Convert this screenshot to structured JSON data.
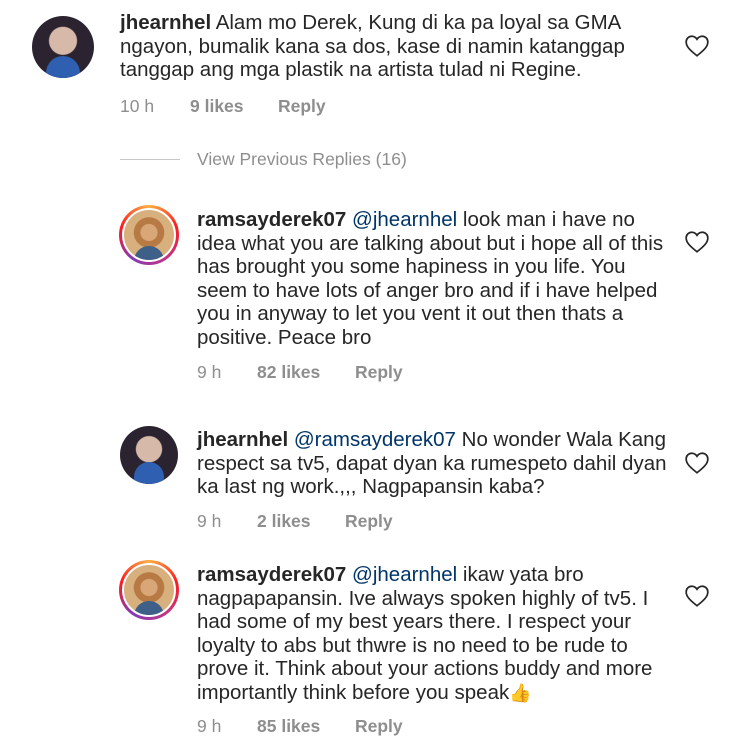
{
  "comments": [
    {
      "username": "jhearnhel",
      "mention": "",
      "text": " Alam mo Derek, Kung di ka pa loyal sa GMA ngayon, bumalik kana sa dos, kase di namin katanggap tanggap ang mga plastik na artista tulad ni Regine.",
      "time": "10 h",
      "likes": "9 likes",
      "reply": "Reply"
    },
    {
      "username": "ramsayderek07",
      "mention": " @jhearnhel",
      "text": " look man i have no idea what you are talking about but i hope all of this has brought you some hapiness in you life. You seem to have lots of anger bro and if i have helped you in anyway to let you vent it out then thats a positive. Peace bro",
      "time": "9 h",
      "likes": "82 likes",
      "reply": "Reply"
    },
    {
      "username": "jhearnhel",
      "mention": " @ramsayderek07",
      "text": " No wonder Wala Kang respect sa tv5, dapat dyan ka rumespeto dahil dyan ka last ng work.,,, Nagpapansin kaba?",
      "time": "9 h",
      "likes": "2 likes",
      "reply": "Reply"
    },
    {
      "username": "ramsayderek07",
      "mention": " @jhearnhel",
      "text": " ikaw yata bro nagpapapansin. Ive always spoken highly of tv5. I had some of my best years there. I respect your loyalty to abs but thwre is no need to be rude to prove it. Think about your actions buddy and more importantly think before you speak",
      "emoji": "👍",
      "time": "9 h",
      "likes": "85 likes",
      "reply": "Reply"
    }
  ],
  "view_previous": "View Previous Replies (16)",
  "icons": {
    "like": "heart-outline-icon",
    "emoji": "thumbs-up-emoji"
  },
  "colors": {
    "text": "#262626",
    "muted": "#8e8e8e",
    "mention": "#003569"
  }
}
